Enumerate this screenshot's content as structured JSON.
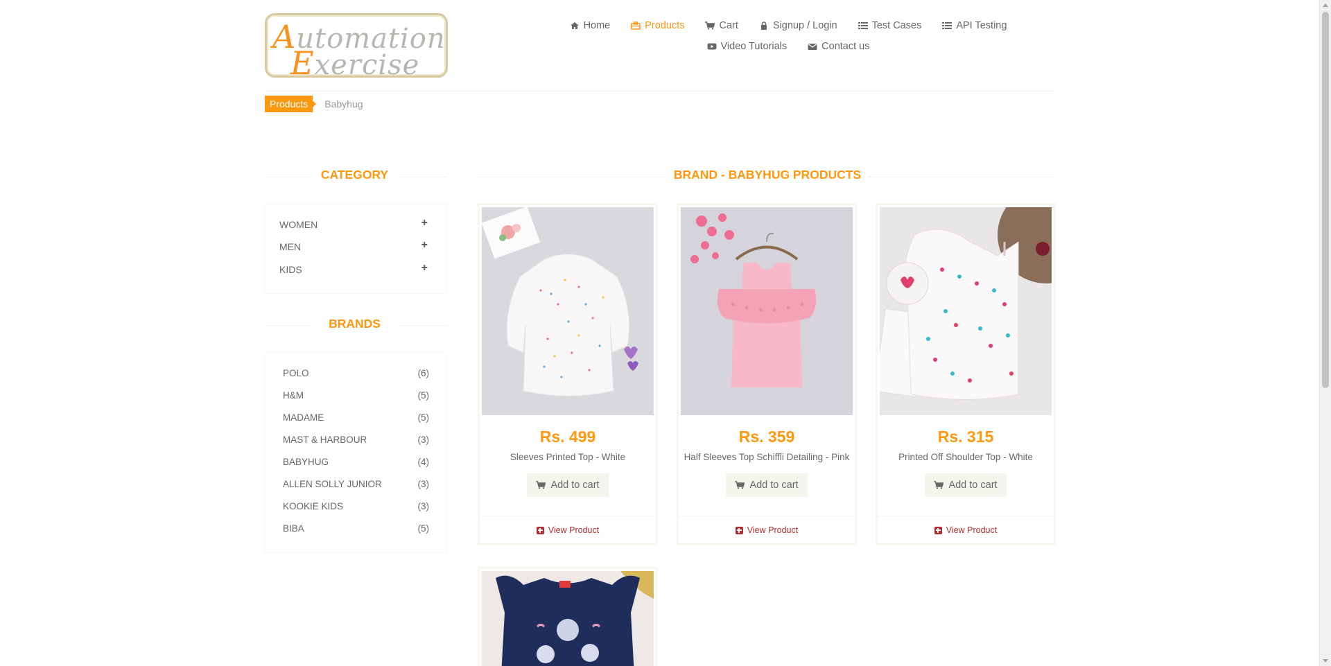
{
  "header": {
    "logo_line1_cap": "A",
    "logo_line1_rest": "utomation",
    "logo_line2_cap": "E",
    "logo_line2_rest": "xercise",
    "nav": [
      {
        "label": "Home",
        "icon": "home-icon"
      },
      {
        "label": "Products",
        "icon": "products-icon",
        "active": true
      },
      {
        "label": "Cart",
        "icon": "cart-icon"
      },
      {
        "label": "Signup / Login",
        "icon": "lock-icon"
      },
      {
        "label": "Test Cases",
        "icon": "list-icon"
      },
      {
        "label": "API Testing",
        "icon": "list-icon"
      },
      {
        "label": "Video Tutorials",
        "icon": "youtube-icon"
      },
      {
        "label": "Contact us",
        "icon": "envelope-icon"
      }
    ]
  },
  "breadcrumb": {
    "active": "Products",
    "current": "Babyhug"
  },
  "sidebar": {
    "category_title": "CATEGORY",
    "categories": [
      "WOMEN",
      "MEN",
      "KIDS"
    ],
    "brands_title": "BRANDS",
    "brands": [
      {
        "name": "POLO",
        "count": "(6)"
      },
      {
        "name": "H&M",
        "count": "(5)"
      },
      {
        "name": "MADAME",
        "count": "(5)"
      },
      {
        "name": "MAST & HARBOUR",
        "count": "(3)"
      },
      {
        "name": "BABYHUG",
        "count": "(4)"
      },
      {
        "name": "ALLEN SOLLY JUNIOR",
        "count": "(3)"
      },
      {
        "name": "KOOKIE KIDS",
        "count": "(3)"
      },
      {
        "name": "BIBA",
        "count": "(5)"
      }
    ]
  },
  "main": {
    "title": "BRAND - BABYHUG PRODUCTS",
    "add_to_cart_label": "Add to cart",
    "view_product_label": "View Product",
    "products": [
      {
        "price": "Rs. 499",
        "name": "Sleeves Printed Top - White",
        "image": "white-printed-top"
      },
      {
        "price": "Rs. 359",
        "name": "Half Sleeves Top Schiffli Detailing - Pink",
        "image": "pink-top-on-hanger"
      },
      {
        "price": "Rs. 315",
        "name": "Printed Off Shoulder Top - White",
        "image": "white-butterfly-top"
      },
      {
        "image": "navy-frock"
      }
    ]
  },
  "colors": {
    "accent": "#FE980F",
    "view_product": "#B02D2D",
    "text": "#696763"
  }
}
